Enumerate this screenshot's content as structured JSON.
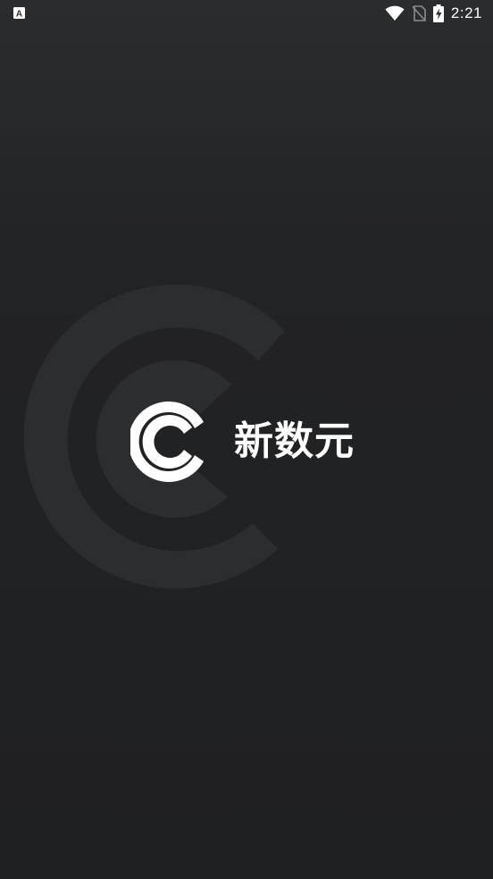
{
  "status_bar": {
    "time": "2:21",
    "left_icon": "app-notification-icon",
    "icons": [
      "wifi-icon",
      "no-sim-icon",
      "battery-charging-icon"
    ]
  },
  "splash": {
    "brand_name": "新数元",
    "logo_icon": "brand-c-logo-icon"
  },
  "colors": {
    "background_top": "#2a2c2e",
    "background_bottom": "#1f2021",
    "ring": "#2c2d2f",
    "foreground": "#ffffff"
  }
}
